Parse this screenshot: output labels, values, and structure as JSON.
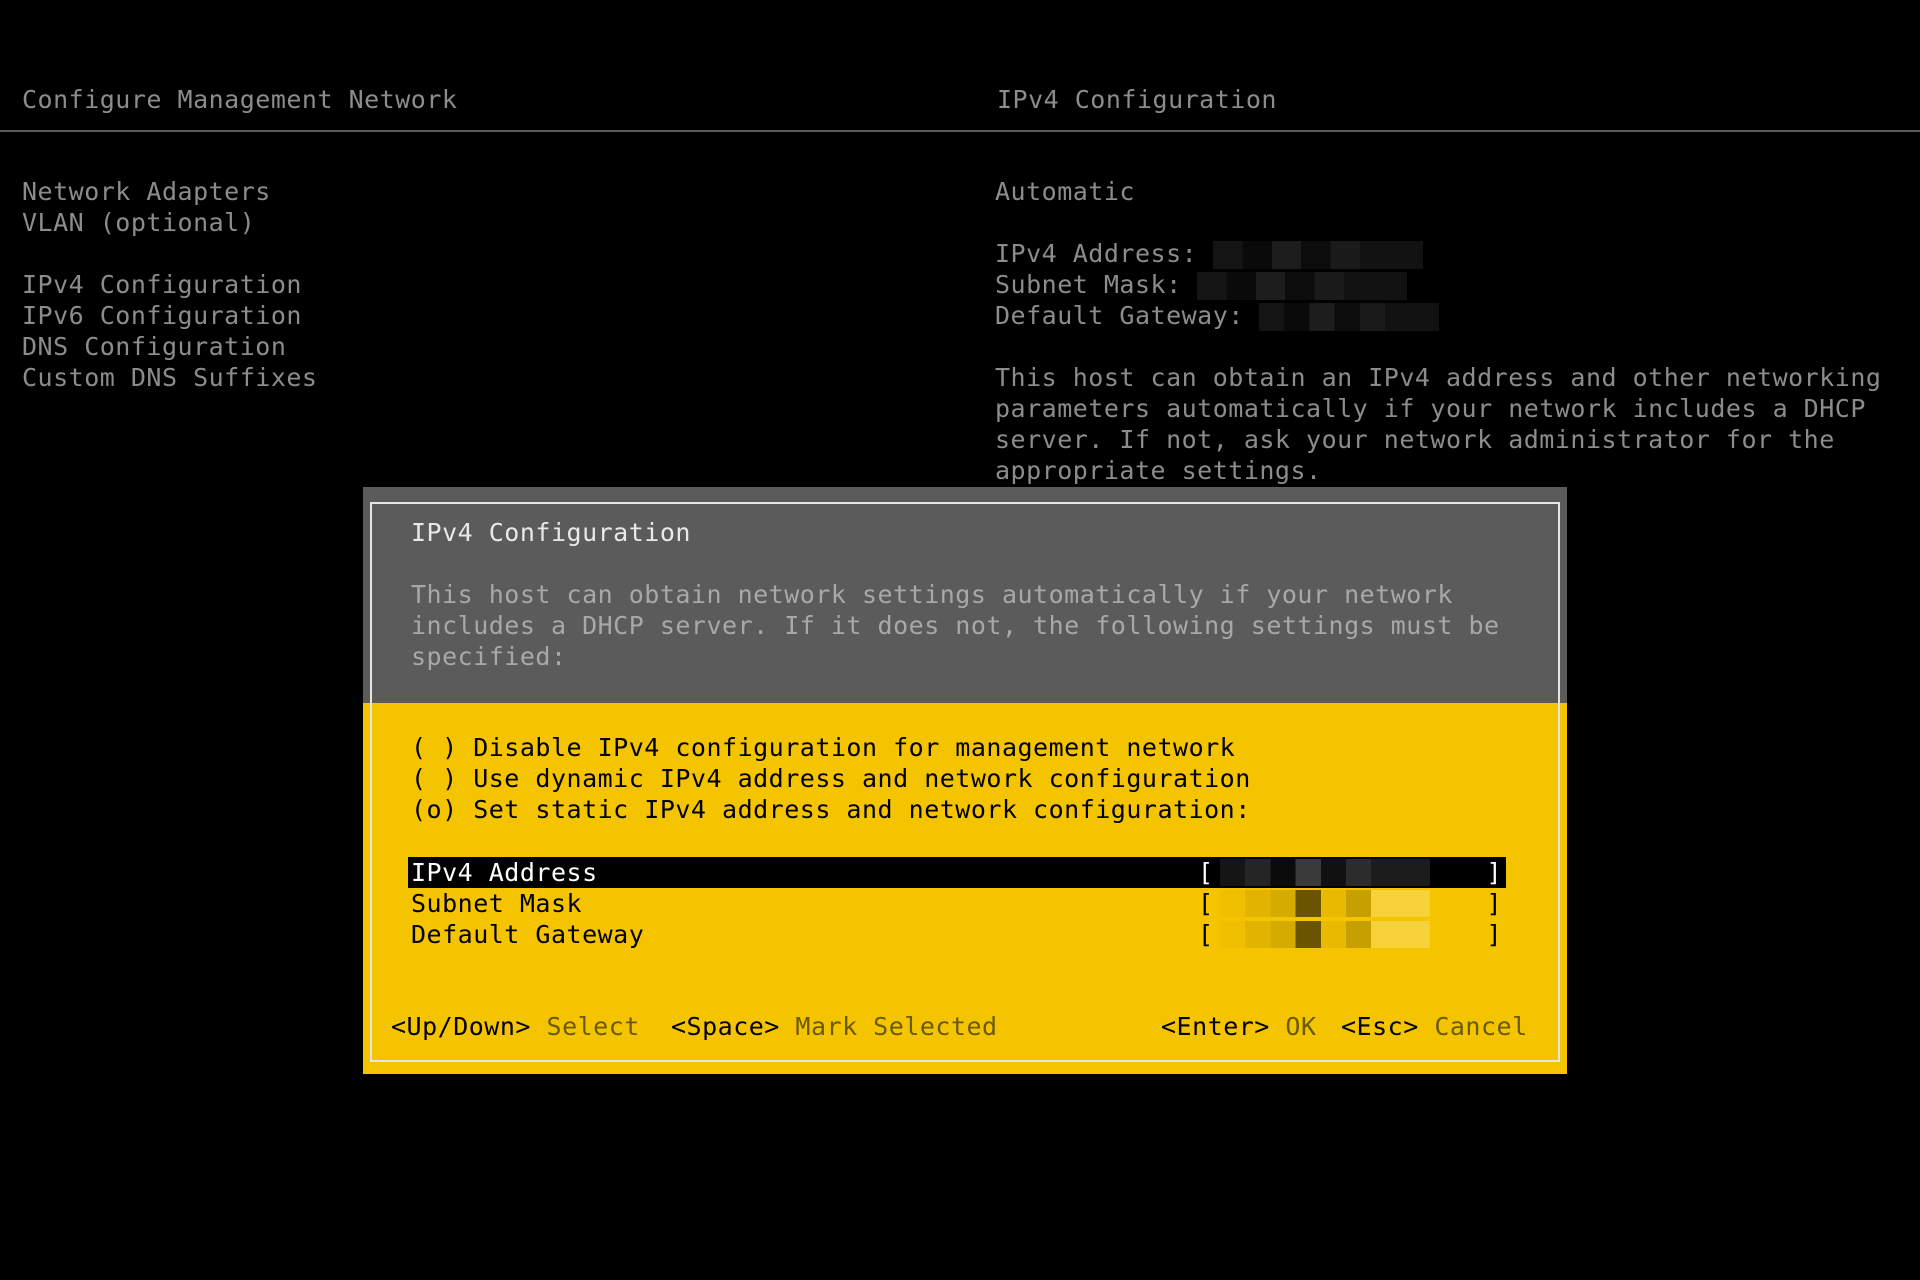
{
  "header": {
    "left_title": "Configure Management Network",
    "right_title": "IPv4 Configuration"
  },
  "menu": {
    "items": [
      "Network Adapters",
      "VLAN (optional)",
      "IPv4 Configuration",
      "IPv6 Configuration",
      "DNS Configuration",
      "Custom DNS Suffixes"
    ]
  },
  "info": {
    "mode": "Automatic",
    "ipv4_address_label": "IPv4 Address:",
    "subnet_mask_label": "Subnet Mask:",
    "default_gateway_label": "Default Gateway:",
    "description": "This host can obtain an IPv4 address and other networking parameters automatically if your network includes a DHCP server. If not, ask your network administrator for the appropriate settings."
  },
  "dialog": {
    "title": "IPv4 Configuration",
    "description": "This host can obtain network settings automatically if your network includes a DHCP server. If it does not, the following settings must be specified:",
    "options": [
      "( ) Disable IPv4 configuration for management network",
      "( ) Use dynamic IPv4 address and network configuration",
      "(o) Set static IPv4 address and network configuration:"
    ],
    "fields": [
      {
        "label": "IPv4 Address",
        "selected": true
      },
      {
        "label": "Subnet Mask",
        "selected": false
      },
      {
        "label": "Default Gateway",
        "selected": false
      }
    ],
    "bracket_open": "[",
    "bracket_close": "]",
    "footer": {
      "updown_key": "<Up/Down>",
      "updown_action": "Select",
      "space_key": "<Space>",
      "space_action": "Mark Selected",
      "enter_key": "<Enter>",
      "enter_action": "OK",
      "esc_key": "<Esc>",
      "esc_action": "Cancel"
    }
  }
}
